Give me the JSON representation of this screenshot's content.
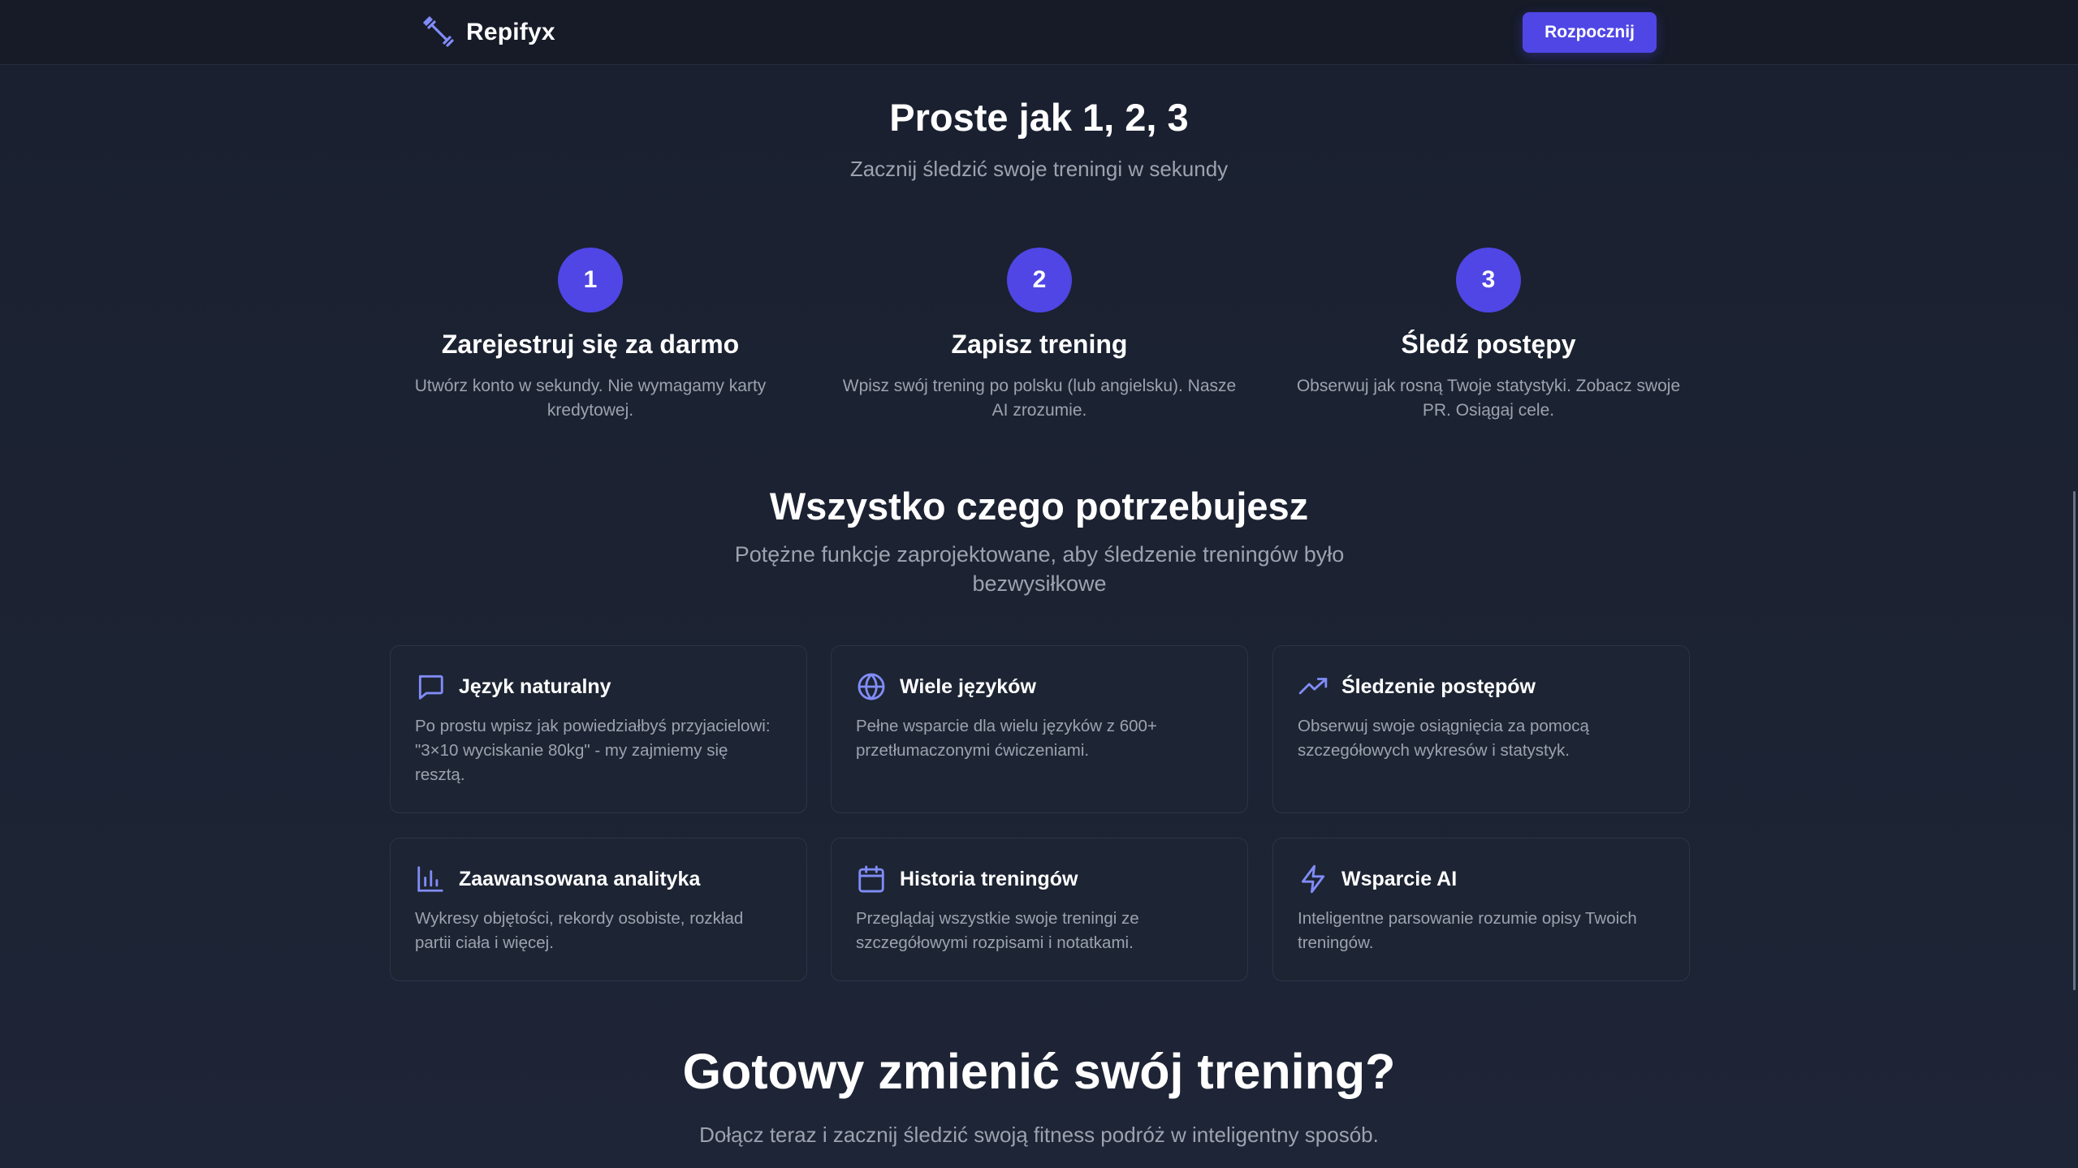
{
  "navbar": {
    "brand": "Repifyx",
    "brand_icon": "dumbbell-icon",
    "cta_label": "Rozpocznij"
  },
  "steps_section": {
    "title": "Proste jak 1, 2, 3",
    "subtitle": "Zacznij śledzić swoje treningi w sekundy",
    "steps": [
      {
        "number": "1",
        "title": "Zarejestruj się za darmo",
        "description": "Utwórz konto w sekundy. Nie wymagamy karty kredytowej."
      },
      {
        "number": "2",
        "title": "Zapisz trening",
        "description": "Wpisz swój trening po polsku (lub angielsku). Nasze AI zrozumie."
      },
      {
        "number": "3",
        "title": "Śledź postępy",
        "description": "Obserwuj jak rosną Twoje statystyki. Zobacz swoje PR. Osiągaj cele."
      }
    ]
  },
  "features_section": {
    "title": "Wszystko czego potrzebujesz",
    "subtitle": "Potężne funkcje zaprojektowane, aby śledzenie treningów było bezwysiłkowe",
    "features": [
      {
        "icon": "chat-bubble-icon",
        "title": "Język naturalny",
        "description": "Po prostu wpisz jak powiedziałbyś przyjacielowi: \"3×10 wyciskanie 80kg\" - my zajmiemy się resztą."
      },
      {
        "icon": "globe-icon",
        "title": "Wiele języków",
        "description": "Pełne wsparcie dla wielu języków z 600+ przetłumaczonymi ćwiczeniami."
      },
      {
        "icon": "trending-up-icon",
        "title": "Śledzenie postępów",
        "description": "Obserwuj swoje osiągnięcia za pomocą szczegółowych wykresów i statystyk."
      },
      {
        "icon": "bar-chart-icon",
        "title": "Zaawansowana analityka",
        "description": "Wykresy objętości, rekordy osobiste, rozkład partii ciała i więcej."
      },
      {
        "icon": "calendar-icon",
        "title": "Historia treningów",
        "description": "Przeglądaj wszystkie swoje treningi ze szczegółowymi rozpisami i notatkami."
      },
      {
        "icon": "lightning-icon",
        "title": "Wsparcie AI",
        "description": "Inteligentne parsowanie rozumie opisy Twoich treningów."
      }
    ]
  },
  "cta_section": {
    "title": "Gotowy zmienić swój trening?",
    "subtitle": "Dołącz teraz i zacznij śledzić swoją fitness podróż w inteligentny sposób."
  },
  "colors": {
    "background": "#1b2130",
    "navbar": "#161b27",
    "accent": "#4f46e5",
    "icon_accent": "#818cf8",
    "muted_text": "#9ca3af",
    "card_border": "#2d3545"
  }
}
